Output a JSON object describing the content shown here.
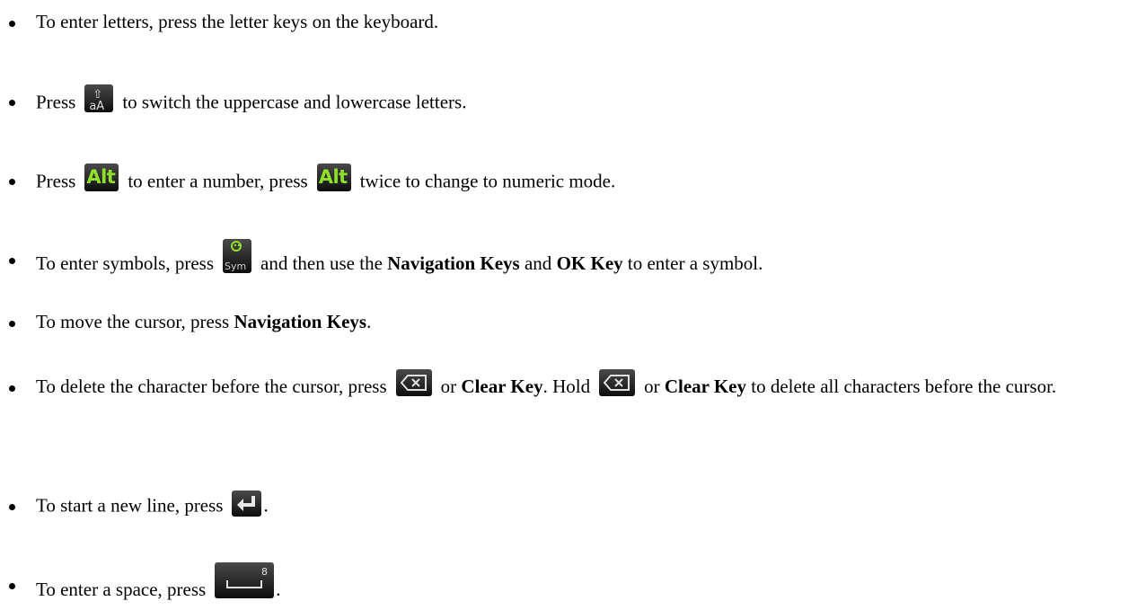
{
  "items": [
    {
      "t1": "To enter letters, press the letter keys on the keyboard."
    },
    {
      "t1": "Press",
      "t2": "to switch the uppercase and lowercase letters.",
      "icon": "shift-aA-key-icon"
    },
    {
      "t1": "Press",
      "t2": "to enter a number, press",
      "t3": "twice to change to numeric mode.",
      "icon": "alt-key-icon"
    },
    {
      "t1": "To enter symbols, press",
      "t2": "and then use the",
      "b1": "Navigation Keys",
      "t3": "and",
      "b2": "OK Key",
      "t4": "to enter a symbol.",
      "icon": "sym-key-icon"
    },
    {
      "t1": "To move the cursor, press",
      "b1": "Navigation Keys",
      "t2": "."
    },
    {
      "t1": "To delete the character before the cursor, press",
      "t2": "or",
      "b1": "Clear Key",
      "t3": ". Hold",
      "t4": "or",
      "b2": "Clear Key",
      "t5": "to delete all characters before the cursor.",
      "icon": "backspace-key-icon"
    },
    {
      "t1": "To start a new line, press",
      "t2": ".",
      "icon": "enter-key-icon"
    },
    {
      "t1": "To enter a space, press",
      "t2": ".",
      "icon": "space-key-icon"
    }
  ],
  "keys": {
    "shift_label": "aA",
    "alt_label": "Alt",
    "sym_label": "Sym"
  },
  "colors": {
    "alt_green": "#8ee02a",
    "key_dark": "#1a1a1a"
  }
}
